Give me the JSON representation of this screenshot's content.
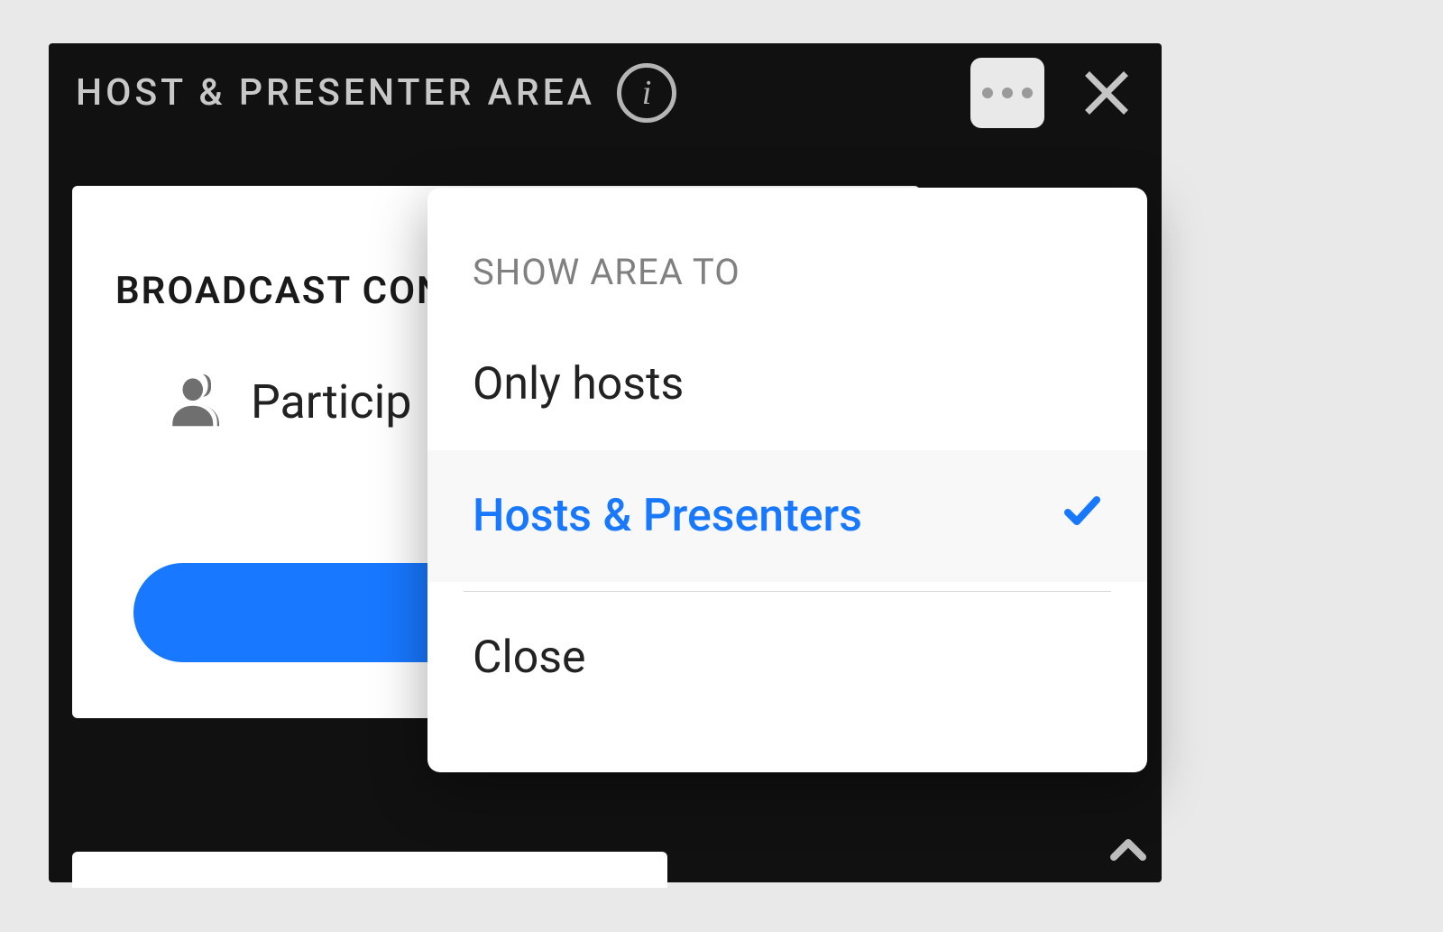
{
  "panel": {
    "title": "HOST & PRESENTER AREA"
  },
  "card": {
    "title": "BROADCAST CON",
    "row_label": "Particip"
  },
  "menu": {
    "header": "SHOW AREA TO",
    "items": [
      {
        "label": "Only hosts",
        "selected": false
      },
      {
        "label": "Hosts & Presenters",
        "selected": true
      }
    ],
    "close_label": "Close"
  }
}
